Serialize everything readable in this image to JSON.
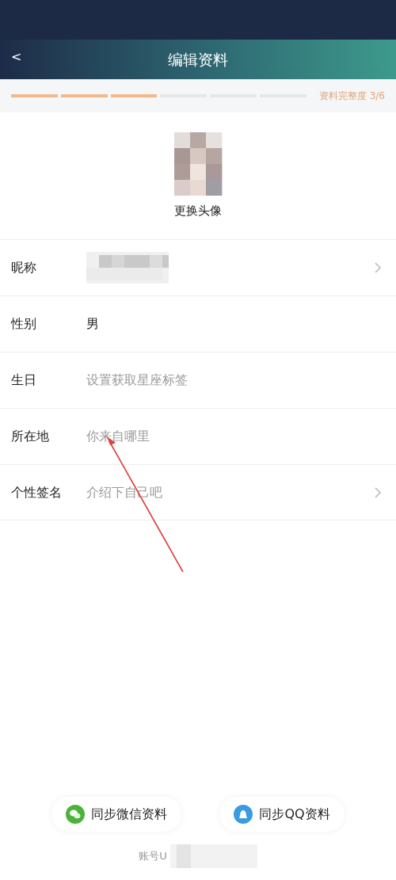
{
  "header": {
    "back": "<",
    "title": "编辑资料"
  },
  "completeness": {
    "label": "资料完整度 3/6",
    "steps": [
      {
        "filled": true
      },
      {
        "filled": true
      },
      {
        "filled": true
      },
      {
        "filled": false
      },
      {
        "filled": false
      },
      {
        "filled": false
      }
    ]
  },
  "avatar": {
    "kind": "picture",
    "action": "更换头像"
  },
  "fields": [
    {
      "label": "昵称",
      "kind": "redacted",
      "chevron": true
    },
    {
      "label": "性别",
      "kind": "value",
      "value": "男",
      "chevron": false
    },
    {
      "label": "生日",
      "kind": "placeholder",
      "placeholder": "设置获取星座标签",
      "chevron": false
    },
    {
      "label": "所在地",
      "kind": "placeholder",
      "placeholder": "你来自哪里",
      "chevron": false
    },
    {
      "label": "个性签名",
      "kind": "placeholder",
      "placeholder": "介绍下自己吧",
      "chevron": true
    }
  ],
  "sync_buttons": [
    {
      "kind": "wechat",
      "label": "同步微信资料"
    },
    {
      "kind": "qq",
      "label": "同步QQ资料"
    }
  ],
  "account": {
    "label": "账号U"
  },
  "annotation": {
    "kind": "arrow"
  }
}
